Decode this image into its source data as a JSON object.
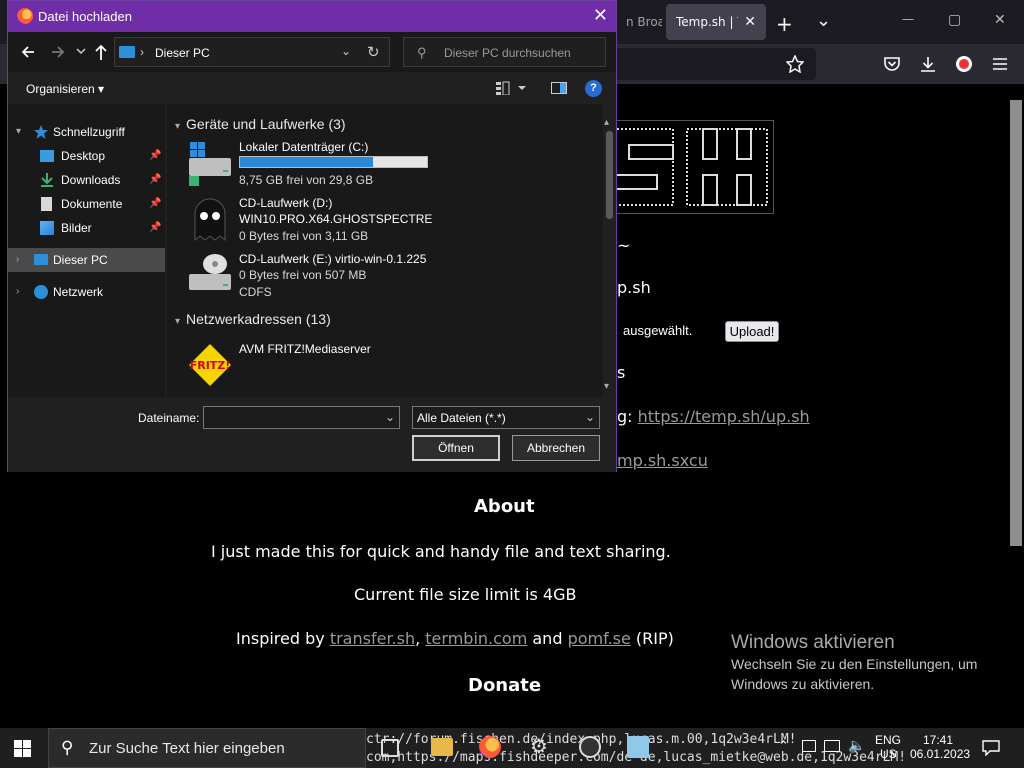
{
  "browser": {
    "tab_bg_label": "n Broa",
    "tab_active_label": "Temp.sh | Te",
    "tab_close": "✕",
    "new_tab": "+",
    "tab_list": "⌄",
    "minimize": "—",
    "maximize": "▢",
    "close": "✕"
  },
  "page": {
    "tilde": "~",
    "curl_line": "p.sh",
    "selected_text": "ausgewählt.",
    "upload_button": "Upload!",
    "s_line": "s",
    "g_prefix": "g: ",
    "up_link": "https://temp.sh/up.sh",
    "sxcu_link": "mp.sh.sxcu",
    "about_heading": "About",
    "about_text": "I just made this for quick and handy file and text sharing.",
    "limit_text": "Current file size limit is 4GB",
    "inspired_prefix": "Inspired by ",
    "link_transfer": "transfer.sh",
    "comma": ", ",
    "link_termbin": "termbin.com",
    "and_text": " and ",
    "link_pomf": "pomf.se",
    "rip_text": " (RIP)",
    "donate_heading": "Donate"
  },
  "activation": {
    "title": "Windows aktivieren",
    "line1": "Wechseln Sie zu den Einstellungen, um",
    "line2": "Windows zu aktivieren."
  },
  "dialog": {
    "title": "Datei hochladen",
    "close": "✕",
    "address": "Dieser PC",
    "search_placeholder": "Dieser PC durchsuchen",
    "organize": "Organisieren ▾",
    "help": "?",
    "nav_items": [
      {
        "label": "Schnellzugriff"
      },
      {
        "label": "Desktop"
      },
      {
        "label": "Downloads"
      },
      {
        "label": "Dokumente"
      },
      {
        "label": "Bilder"
      },
      {
        "label": "Dieser PC"
      },
      {
        "label": "Netzwerk"
      }
    ],
    "group_devices": "Geräte und Laufwerke (3)",
    "group_network": "Netzwerkadressen (13)",
    "drives": [
      {
        "name": "Lokaler Datenträger (C:)",
        "status": "8,75 GB frei von 29,8 GB",
        "used_fraction": 0.71
      },
      {
        "name": "CD-Laufwerk (D:)",
        "subname": "WIN10.PRO.X64.GHOSTSPECTRE",
        "status": "0 Bytes frei von 3,11 GB"
      },
      {
        "name": "CD-Laufwerk (E:) virtio-win-0.1.225",
        "status": "0 Bytes frei von 507 MB",
        "fs": "CDFS"
      }
    ],
    "network_items": [
      {
        "name": "AVM FRITZ!Mediaserver",
        "icon_text": "FRITZ!"
      }
    ],
    "filename_label": "Dateiname:",
    "filename_value": "",
    "filter_value": "Alle Dateien (*.*)",
    "open_button": "Öffnen",
    "cancel_button": "Abbrechen"
  },
  "taskbar": {
    "search_placeholder": "Zur Suche Text hier eingeben",
    "text_line1": "ctr://forum.fischen.de/index.php,lucas.m.00,1q2w3e4rLM!",
    "text_line2": "com,https://maps.fishdeeper.com/de-de,lucas_mietke@web.de,1q2w3e4rLM!",
    "lang": "ENG",
    "region": "US",
    "time": "17:41",
    "date": "06.01.2023"
  }
}
